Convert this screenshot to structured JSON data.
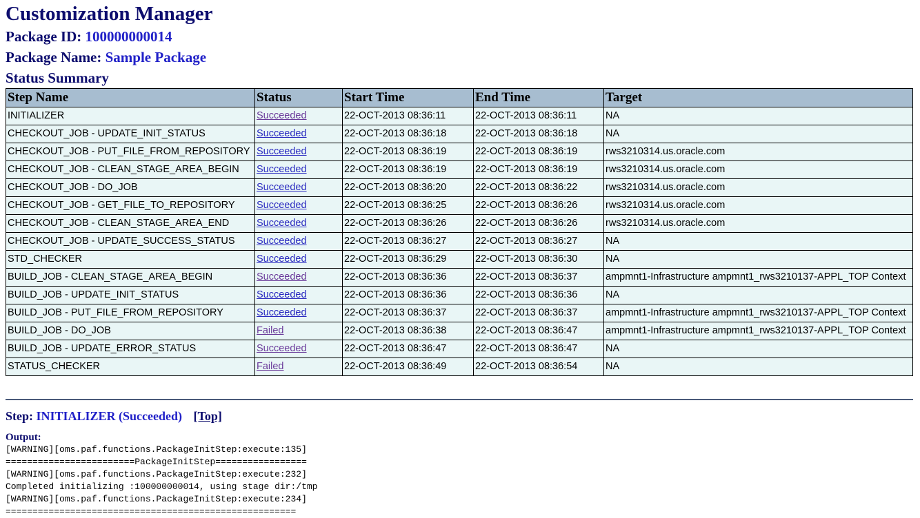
{
  "title": "Customization Manager",
  "package": {
    "id_label": "Package ID:",
    "id_value": "100000000014",
    "name_label": "Package Name:",
    "name_value": "Sample Package"
  },
  "summary": {
    "heading": "Status Summary",
    "columns": [
      "Step Name",
      "Status",
      "Start Time",
      "End Time",
      "Target"
    ],
    "rows": [
      {
        "step": "INITIALIZER",
        "status": "Succeeded",
        "start": "22-OCT-2013 08:36:11",
        "end": "22-OCT-2013 08:36:11",
        "target": "NA",
        "visited": true
      },
      {
        "step": "CHECKOUT_JOB - UPDATE_INIT_STATUS",
        "status": "Succeeded",
        "start": "22-OCT-2013 08:36:18",
        "end": "22-OCT-2013 08:36:18",
        "target": "NA",
        "visited": false
      },
      {
        "step": "CHECKOUT_JOB - PUT_FILE_FROM_REPOSITORY",
        "status": "Succeeded",
        "start": "22-OCT-2013 08:36:19",
        "end": "22-OCT-2013 08:36:19",
        "target": "rws3210314.us.oracle.com",
        "visited": false
      },
      {
        "step": "CHECKOUT_JOB - CLEAN_STAGE_AREA_BEGIN",
        "status": "Succeeded",
        "start": "22-OCT-2013 08:36:19",
        "end": "22-OCT-2013 08:36:19",
        "target": "rws3210314.us.oracle.com",
        "visited": false
      },
      {
        "step": "CHECKOUT_JOB - DO_JOB",
        "status": "Succeeded",
        "start": "22-OCT-2013 08:36:20",
        "end": "22-OCT-2013 08:36:22",
        "target": "rws3210314.us.oracle.com",
        "visited": false
      },
      {
        "step": "CHECKOUT_JOB - GET_FILE_TO_REPOSITORY",
        "status": "Succeeded",
        "start": "22-OCT-2013 08:36:25",
        "end": "22-OCT-2013 08:36:26",
        "target": "rws3210314.us.oracle.com",
        "visited": false
      },
      {
        "step": "CHECKOUT_JOB - CLEAN_STAGE_AREA_END",
        "status": "Succeeded",
        "start": "22-OCT-2013 08:36:26",
        "end": "22-OCT-2013 08:36:26",
        "target": "rws3210314.us.oracle.com",
        "visited": false
      },
      {
        "step": "CHECKOUT_JOB - UPDATE_SUCCESS_STATUS",
        "status": "Succeeded",
        "start": "22-OCT-2013 08:36:27",
        "end": "22-OCT-2013 08:36:27",
        "target": "NA",
        "visited": false
      },
      {
        "step": "STD_CHECKER",
        "status": "Succeeded",
        "start": "22-OCT-2013 08:36:29",
        "end": "22-OCT-2013 08:36:30",
        "target": "NA",
        "visited": false
      },
      {
        "step": "BUILD_JOB - CLEAN_STAGE_AREA_BEGIN",
        "status": "Succeeded",
        "start": "22-OCT-2013 08:36:36",
        "end": "22-OCT-2013 08:36:37",
        "target": "ampmnt1-Infrastructure ampmnt1_rws3210137-APPL_TOP Context",
        "visited": true
      },
      {
        "step": "BUILD_JOB - UPDATE_INIT_STATUS",
        "status": "Succeeded",
        "start": "22-OCT-2013 08:36:36",
        "end": "22-OCT-2013 08:36:36",
        "target": "NA",
        "visited": false
      },
      {
        "step": "BUILD_JOB - PUT_FILE_FROM_REPOSITORY",
        "status": "Succeeded",
        "start": "22-OCT-2013 08:36:37",
        "end": "22-OCT-2013 08:36:37",
        "target": "ampmnt1-Infrastructure ampmnt1_rws3210137-APPL_TOP Context",
        "visited": false
      },
      {
        "step": "BUILD_JOB - DO_JOB",
        "status": "Failed",
        "start": "22-OCT-2013 08:36:38",
        "end": "22-OCT-2013 08:36:47",
        "target": "ampmnt1-Infrastructure ampmnt1_rws3210137-APPL_TOP Context",
        "visited": true
      },
      {
        "step": "BUILD_JOB - UPDATE_ERROR_STATUS",
        "status": "Succeeded",
        "start": "22-OCT-2013 08:36:47",
        "end": "22-OCT-2013 08:36:47",
        "target": "NA",
        "visited": true
      },
      {
        "step": "STATUS_CHECKER",
        "status": "Failed",
        "start": "22-OCT-2013 08:36:49",
        "end": "22-OCT-2013 08:36:54",
        "target": "NA",
        "visited": true
      }
    ]
  },
  "step_detail": {
    "label": "Step:",
    "value": "INITIALIZER (Succeeded)",
    "top_link": "[Top]",
    "output_label": "Output:",
    "output_lines": [
      "[WARNING][oms.paf.functions.PackageInitStep:execute:135]",
      "========================PackageInitStep=================",
      "[WARNING][oms.paf.functions.PackageInitStep:execute:232]",
      "Completed initializing :100000000014, using stage dir:/tmp",
      "[WARNING][oms.paf.functions.PackageInitStep:execute:234]",
      "======================================================"
    ]
  },
  "colors": {
    "heading": "#0d0d6e",
    "value": "#2121c8",
    "header_bg": "#a7bdd0",
    "cell_bg": "#e9f6f6",
    "link": "#2a2ac0",
    "link_visited": "#6a3a9a"
  }
}
